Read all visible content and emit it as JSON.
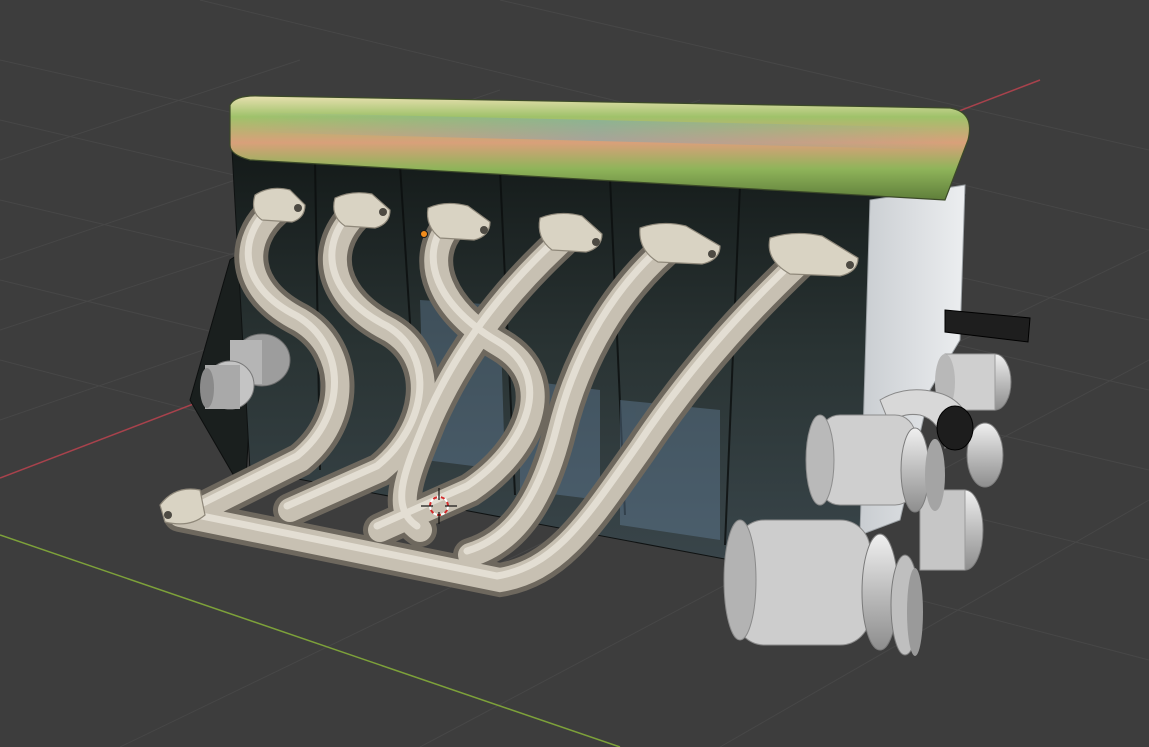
{
  "app": "3D Viewport",
  "viewport": {
    "background": "#3d3d3d",
    "grid_color": "#4a4a4a",
    "x_axis_color": "#a8424c",
    "y_axis_color": "#7da13a"
  },
  "scene": {
    "object": "inline-6-engine-block",
    "cylinders": 6,
    "valve_cover_colors": [
      "#c9b35a",
      "#8fbf5c",
      "#d98e6a",
      "#6ea1b3"
    ],
    "header_pipe_color": "#b9b2a6",
    "block_color": "#1e2523",
    "pulley_color": "#c8c8c8"
  },
  "gizmos": {
    "cursor": "3d-cursor-icon",
    "origin": "object-origin-dot",
    "origin_color": "#f28c1c"
  }
}
